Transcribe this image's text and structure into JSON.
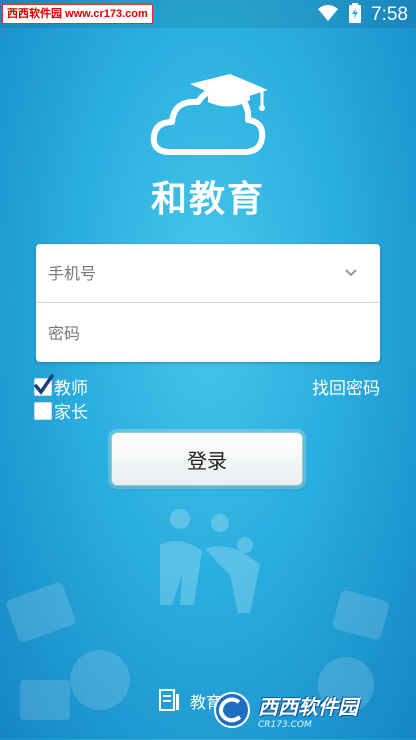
{
  "status_bar": {
    "watermark": "西西软件园 www.cr173.com",
    "time": "7:58"
  },
  "app": {
    "title": "和教育"
  },
  "login_form": {
    "phone_placeholder": "手机号",
    "password_placeholder": "密码",
    "role_teacher": "教师",
    "role_teacher_checked": true,
    "role_parent": "家长",
    "role_parent_checked": false,
    "forgot_password": "找回密码",
    "login_button": "登录"
  },
  "footer": {
    "label": "教育",
    "watermark_brand": "西西软件园",
    "watermark_brand_en": "CR173.COM"
  },
  "colors": {
    "background": "#2aaedf",
    "text_on_bg": "#ffffff"
  }
}
